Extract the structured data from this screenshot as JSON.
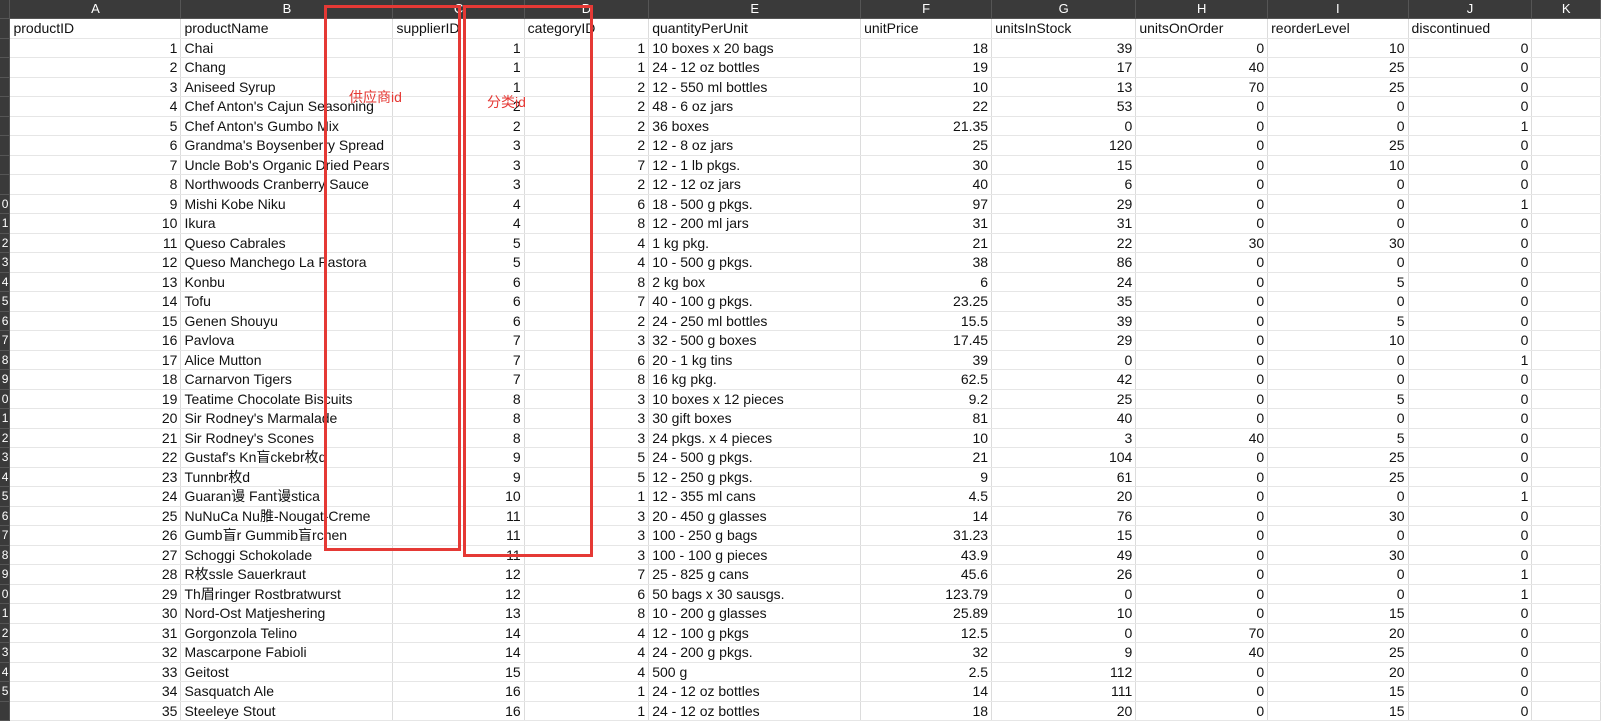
{
  "columns": [
    "A",
    "B",
    "C",
    "D",
    "E",
    "F",
    "G",
    "H",
    "I",
    "J",
    "K"
  ],
  "headers": [
    "productID",
    "productName",
    "supplierID",
    "categoryID",
    "quantityPerUnit",
    "unitPrice",
    "unitsInStock",
    "unitsOnOrder",
    "reorderLevel",
    "discontinued",
    ""
  ],
  "rownums": [
    "",
    "",
    "",
    "",
    "",
    "",
    "",
    "",
    "",
    "0",
    "1",
    "2",
    "3",
    "4",
    "5",
    "6",
    "7",
    "8",
    "9",
    "0",
    "1",
    "2",
    "3",
    "4",
    "5",
    "6",
    "7",
    "8",
    "9",
    "0",
    "1",
    "2",
    "3",
    "4",
    "5",
    ""
  ],
  "rows": [
    [
      "1",
      "Chai",
      "1",
      "1",
      "10 boxes x 20 bags",
      "18",
      "39",
      "0",
      "10",
      "0"
    ],
    [
      "2",
      "Chang",
      "1",
      "1",
      "24 - 12 oz bottles",
      "19",
      "17",
      "40",
      "25",
      "0"
    ],
    [
      "3",
      "Aniseed Syrup",
      "1",
      "2",
      "12 - 550 ml bottles",
      "10",
      "13",
      "70",
      "25",
      "0"
    ],
    [
      "4",
      "Chef Anton's Cajun Seasoning",
      "2",
      "2",
      "48 - 6 oz jars",
      "22",
      "53",
      "0",
      "0",
      "0"
    ],
    [
      "5",
      "Chef Anton's Gumbo Mix",
      "2",
      "2",
      "36 boxes",
      "21.35",
      "0",
      "0",
      "0",
      "1"
    ],
    [
      "6",
      "Grandma's Boysenberry Spread",
      "3",
      "2",
      "12 - 8 oz jars",
      "25",
      "120",
      "0",
      "25",
      "0"
    ],
    [
      "7",
      "Uncle Bob's Organic Dried Pears",
      "3",
      "7",
      "12 - 1 lb pkgs.",
      "30",
      "15",
      "0",
      "10",
      "0"
    ],
    [
      "8",
      "Northwoods Cranberry Sauce",
      "3",
      "2",
      "12 - 12 oz jars",
      "40",
      "6",
      "0",
      "0",
      "0"
    ],
    [
      "9",
      "Mishi Kobe Niku",
      "4",
      "6",
      "18 - 500 g pkgs.",
      "97",
      "29",
      "0",
      "0",
      "1"
    ],
    [
      "10",
      "Ikura",
      "4",
      "8",
      "12 - 200 ml jars",
      "31",
      "31",
      "0",
      "0",
      "0"
    ],
    [
      "11",
      "Queso Cabrales",
      "5",
      "4",
      "1 kg pkg.",
      "21",
      "22",
      "30",
      "30",
      "0"
    ],
    [
      "12",
      "Queso Manchego La Pastora",
      "5",
      "4",
      "10 - 500 g pkgs.",
      "38",
      "86",
      "0",
      "0",
      "0"
    ],
    [
      "13",
      "Konbu",
      "6",
      "8",
      "2 kg box",
      "6",
      "24",
      "0",
      "5",
      "0"
    ],
    [
      "14",
      "Tofu",
      "6",
      "7",
      "40 - 100 g pkgs.",
      "23.25",
      "35",
      "0",
      "0",
      "0"
    ],
    [
      "15",
      "Genen Shouyu",
      "6",
      "2",
      "24 - 250 ml bottles",
      "15.5",
      "39",
      "0",
      "5",
      "0"
    ],
    [
      "16",
      "Pavlova",
      "7",
      "3",
      "32 - 500 g boxes",
      "17.45",
      "29",
      "0",
      "10",
      "0"
    ],
    [
      "17",
      "Alice Mutton",
      "7",
      "6",
      "20 - 1 kg tins",
      "39",
      "0",
      "0",
      "0",
      "1"
    ],
    [
      "18",
      "Carnarvon Tigers",
      "7",
      "8",
      "16 kg pkg.",
      "62.5",
      "42",
      "0",
      "0",
      "0"
    ],
    [
      "19",
      "Teatime Chocolate Biscuits",
      "8",
      "3",
      "10 boxes x 12 pieces",
      "9.2",
      "25",
      "0",
      "5",
      "0"
    ],
    [
      "20",
      "Sir Rodney's Marmalade",
      "8",
      "3",
      "30 gift boxes",
      "81",
      "40",
      "0",
      "0",
      "0"
    ],
    [
      "21",
      "Sir Rodney's Scones",
      "8",
      "3",
      "24 pkgs. x 4 pieces",
      "10",
      "3",
      "40",
      "5",
      "0"
    ],
    [
      "22",
      "Gustaf's Kn盲ckebr枚d",
      "9",
      "5",
      "24 - 500 g pkgs.",
      "21",
      "104",
      "0",
      "25",
      "0"
    ],
    [
      "23",
      "Tunnbr枚d",
      "9",
      "5",
      "12 - 250 g pkgs.",
      "9",
      "61",
      "0",
      "25",
      "0"
    ],
    [
      "24",
      "Guaran谩 Fant谩stica",
      "10",
      "1",
      "12 - 355 ml cans",
      "4.5",
      "20",
      "0",
      "0",
      "1"
    ],
    [
      "25",
      "NuNuCa Nu脽-Nougat-Creme",
      "11",
      "3",
      "20 - 450 g glasses",
      "14",
      "76",
      "0",
      "30",
      "0"
    ],
    [
      "26",
      "Gumb盲r Gummib盲rchen",
      "11",
      "3",
      "100 - 250 g bags",
      "31.23",
      "15",
      "0",
      "0",
      "0"
    ],
    [
      "27",
      "Schoggi Schokolade",
      "11",
      "3",
      "100 - 100 g pieces",
      "43.9",
      "49",
      "0",
      "30",
      "0"
    ],
    [
      "28",
      "R枚ssle Sauerkraut",
      "12",
      "7",
      "25 - 825 g cans",
      "45.6",
      "26",
      "0",
      "0",
      "1"
    ],
    [
      "29",
      "Th眉ringer Rostbratwurst",
      "12",
      "6",
      "50 bags x 30 sausgs.",
      "123.79",
      "0",
      "0",
      "0",
      "1"
    ],
    [
      "30",
      "Nord-Ost Matjeshering",
      "13",
      "8",
      "10 - 200 g glasses",
      "25.89",
      "10",
      "0",
      "15",
      "0"
    ],
    [
      "31",
      "Gorgonzola Telino",
      "14",
      "4",
      "12 - 100 g pkgs",
      "12.5",
      "0",
      "70",
      "20",
      "0"
    ],
    [
      "32",
      "Mascarpone Fabioli",
      "14",
      "4",
      "24 - 200 g pkgs.",
      "32",
      "9",
      "40",
      "25",
      "0"
    ],
    [
      "33",
      "Geitost",
      "15",
      "4",
      "500 g",
      "2.5",
      "112",
      "0",
      "20",
      "0"
    ],
    [
      "34",
      "Sasquatch Ale",
      "16",
      "1",
      "24 - 12 oz bottles",
      "14",
      "111",
      "0",
      "15",
      "0"
    ],
    [
      "35",
      "Steeleye Stout",
      "16",
      "1",
      "24 - 12 oz bottles",
      "18",
      "20",
      "0",
      "15",
      "0"
    ]
  ],
  "annotations": {
    "supplier_label": "供应商id",
    "category_label": "分类id",
    "color": "#e53935"
  }
}
